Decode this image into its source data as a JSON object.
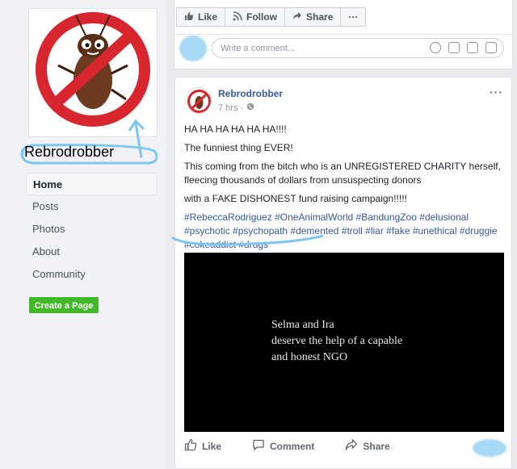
{
  "sidebar": {
    "page_name": "Rebrodrobber",
    "nav": [
      "Home",
      "Posts",
      "Photos",
      "About",
      "Community"
    ],
    "create_page": "Create a Page"
  },
  "top_actions": {
    "like": "Like",
    "follow": "Follow",
    "share": "Share",
    "more": "···"
  },
  "comment": {
    "placeholder": "Write a comment..."
  },
  "post": {
    "author": "Rebrodrobber",
    "time": "7 hrs ·",
    "more": "···",
    "lines": [
      "HA HA HA HA HA HA!!!!",
      "The funniest thing EVER!",
      "This coming from the bitch who is an UNREGISTERED CHARITY herself, fleecing thousands of dollars from unsuspecting donors",
      "with a FAKE DISHONEST fund raising campaign!!!!!"
    ],
    "hashtags": "#RebeccaRodriguez #OneAnimalWorld #BandungZoo #delusional #psychotic #psychopath #demented #troll #liar #fake #unethical #druggie #cokeaddict #drugs",
    "video_caption": [
      "Selma and Ira",
      "deserve the help of a capable",
      "and honest NGO"
    ],
    "actions": {
      "like": "Like",
      "comment": "Comment",
      "share": "Share"
    }
  },
  "colors": {
    "link": "#365899",
    "green_button": "#42b72a",
    "highlight": "#a6d9f5"
  }
}
